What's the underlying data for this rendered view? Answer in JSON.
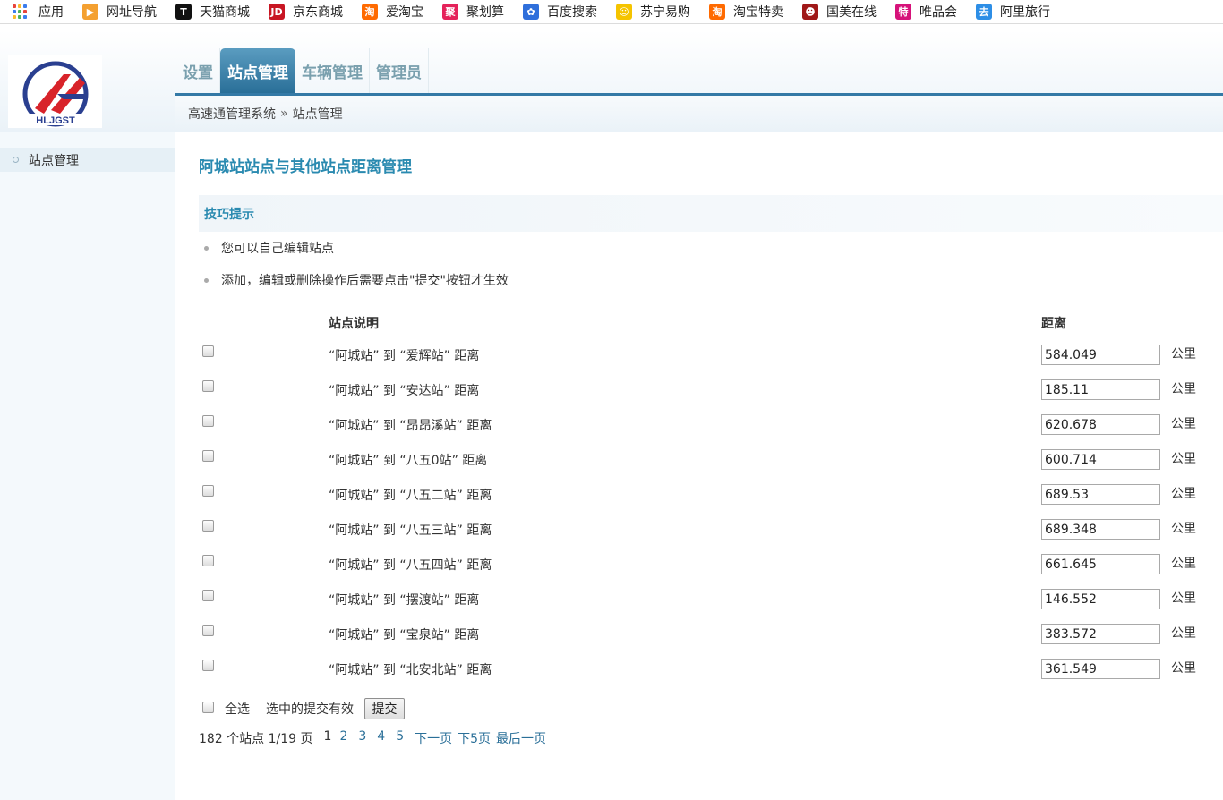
{
  "bookmarks": [
    {
      "label": "应用",
      "icon": "apps-grid-icon"
    },
    {
      "label": "网址导航",
      "icon": "nav-arrow-icon",
      "color": "#f4a030",
      "glyph": "▶"
    },
    {
      "label": "天猫商城",
      "icon": "tmall-icon",
      "color": "#111111",
      "glyph": "T"
    },
    {
      "label": "京东商城",
      "icon": "jd-icon",
      "color": "#c81623",
      "glyph": "JD"
    },
    {
      "label": "爱淘宝",
      "icon": "taobao-icon",
      "color": "#ff6a00",
      "glyph": "淘"
    },
    {
      "label": "聚划算",
      "icon": "juhuasuan-icon",
      "color": "#e5225a",
      "glyph": "聚"
    },
    {
      "label": "百度搜索",
      "icon": "baidu-paw-icon",
      "color": "#2f6fdb",
      "glyph": "✿"
    },
    {
      "label": "苏宁易购",
      "icon": "suning-icon",
      "color": "#f5c400",
      "glyph": "☺"
    },
    {
      "label": "淘宝特卖",
      "icon": "taobao-sale-icon",
      "color": "#ff6a00",
      "glyph": "淘"
    },
    {
      "label": "国美在线",
      "icon": "gome-icon",
      "color": "#a01818",
      "glyph": "☻"
    },
    {
      "label": "唯品会",
      "icon": "vip-icon",
      "color": "#d6137a",
      "glyph": "特"
    },
    {
      "label": "阿里旅行",
      "icon": "alitrip-icon",
      "color": "#2d8ee6",
      "glyph": "去"
    }
  ],
  "nav": {
    "tabs": [
      {
        "label": "设置",
        "active": false
      },
      {
        "label": "站点管理",
        "active": true
      },
      {
        "label": "车辆管理",
        "active": false
      },
      {
        "label": "管理员",
        "active": false
      }
    ]
  },
  "breadcrumb": {
    "root": "高速通管理系统",
    "separator": "»",
    "current": "站点管理"
  },
  "sidebar": {
    "items": [
      {
        "label": "站点管理"
      }
    ]
  },
  "main": {
    "title": "阿城站站点与其他站点距离管理",
    "tips_title": "技巧提示",
    "tips": [
      "您可以自己编辑站点",
      "添加，编辑或删除操作后需要点击\"提交\"按钮才生效"
    ],
    "columns": {
      "desc": "站点说明",
      "distance": "距离"
    },
    "unit": "公里",
    "rows": [
      {
        "label": "“阿城站” 到 “爱辉站” 距离",
        "distance": "584.049"
      },
      {
        "label": "“阿城站” 到 “安达站” 距离",
        "distance": "185.11"
      },
      {
        "label": "“阿城站” 到 “昂昂溪站” 距离",
        "distance": "620.678"
      },
      {
        "label": "“阿城站” 到 “八五0站” 距离",
        "distance": "600.714"
      },
      {
        "label": "“阿城站” 到 “八五二站” 距离",
        "distance": "689.53"
      },
      {
        "label": "“阿城站” 到 “八五三站” 距离",
        "distance": "689.348"
      },
      {
        "label": "“阿城站” 到 “八五四站” 距离",
        "distance": "661.645"
      },
      {
        "label": "“阿城站” 到 “摆渡站” 距离",
        "distance": "146.552"
      },
      {
        "label": "“阿城站” 到 “宝泉站” 距离",
        "distance": "383.572"
      },
      {
        "label": "“阿城站” 到 “北安北站” 距离",
        "distance": "361.549"
      }
    ],
    "select_all": "全选",
    "select_hint": "选中的提交有效",
    "submit": "提交",
    "pager": {
      "info": "182 个站点 1/19 页",
      "pages": [
        "1",
        "2",
        "3",
        "4",
        "5"
      ],
      "next": "下一页",
      "next5": "下5页",
      "last": "最后一页"
    }
  }
}
